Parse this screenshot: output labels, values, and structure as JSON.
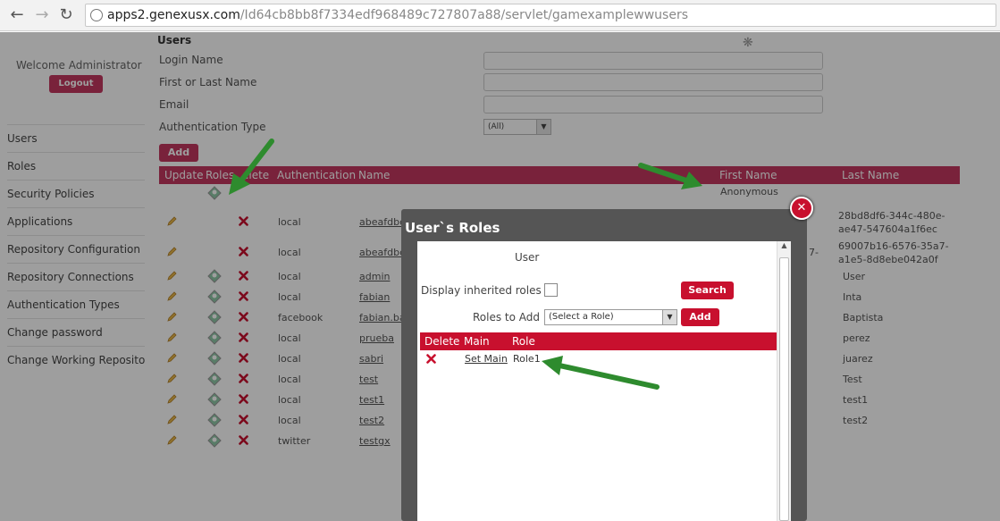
{
  "browser": {
    "back_icon": "back-arrow-icon",
    "forward_icon": "forward-arrow-icon",
    "reload_icon": "reload-icon",
    "url_host": "apps2.genexusx.com",
    "url_path": "/Id64cb8bb8f7334edf968489c727807a88/servlet/gamexamplewwusers"
  },
  "sidebar": {
    "welcome": "Welcome Administrator",
    "logout": "Logout",
    "items": [
      {
        "label": "Users"
      },
      {
        "label": "Roles"
      },
      {
        "label": "Security Policies"
      },
      {
        "label": "Applications"
      },
      {
        "label": "Repository Configuration"
      },
      {
        "label": "Repository Connections"
      },
      {
        "label": "Authentication Types"
      },
      {
        "label": "Change password"
      },
      {
        "label": "Change Working Repository"
      }
    ]
  },
  "main": {
    "title": "Users",
    "filters": {
      "login_name": "Login Name",
      "first_last_name": "First or Last Name",
      "email": "Email",
      "auth_type": "Authentication Type",
      "auth_type_value": "(All)"
    },
    "add_label": "Add",
    "grid": {
      "headers": {
        "update": "Update",
        "roles": "Roles",
        "delete": "elete",
        "authentication": "Authentication",
        "name": "Name",
        "first_name": "First Name",
        "last_name": "Last Name"
      },
      "anonymous": "Anonymous",
      "rows": [
        {
          "auth": "local",
          "name": "abeafdbc",
          "last": "28bd8df6-344c-480e-",
          "last2": "ae47-547604a1f6ec"
        },
        {
          "auth": "local",
          "name": "abeafdbc",
          "first_frag": "7-",
          "last": "69007b16-6576-35a7-",
          "last2": "a1e5-8d8ebe042a0f"
        },
        {
          "auth": "local",
          "name": "admin",
          "last": "User"
        },
        {
          "auth": "local",
          "name": "fabian",
          "last": "Inta"
        },
        {
          "auth": "facebook",
          "name": "fabian.ba",
          "last": "Baptista"
        },
        {
          "auth": "local",
          "name": "prueba",
          "last": "perez"
        },
        {
          "auth": "local",
          "name": "sabri",
          "last": "juarez"
        },
        {
          "auth": "local",
          "name": "test",
          "last": "Test"
        },
        {
          "auth": "local",
          "name": "test1",
          "last": "test1"
        },
        {
          "auth": "local",
          "name": "test2",
          "last": "test2"
        },
        {
          "auth": "twitter",
          "name": "testgx",
          "last": ""
        }
      ]
    }
  },
  "modal": {
    "title": "User`s Roles",
    "user_label": "User",
    "display_inherited": "Display inherited roles",
    "search": "Search",
    "roles_to_add": "Roles to Add",
    "select_value": "(Select a Role)",
    "add": "Add",
    "grid_headers": {
      "delete": "Delete",
      "main": "Main",
      "role": "Role"
    },
    "rows": [
      {
        "main": "Set Main",
        "role": "Role1"
      }
    ]
  },
  "colors": {
    "accent": "#c4375f",
    "modal_accent": "#c8102e",
    "arrow": "#2e8b2e"
  }
}
